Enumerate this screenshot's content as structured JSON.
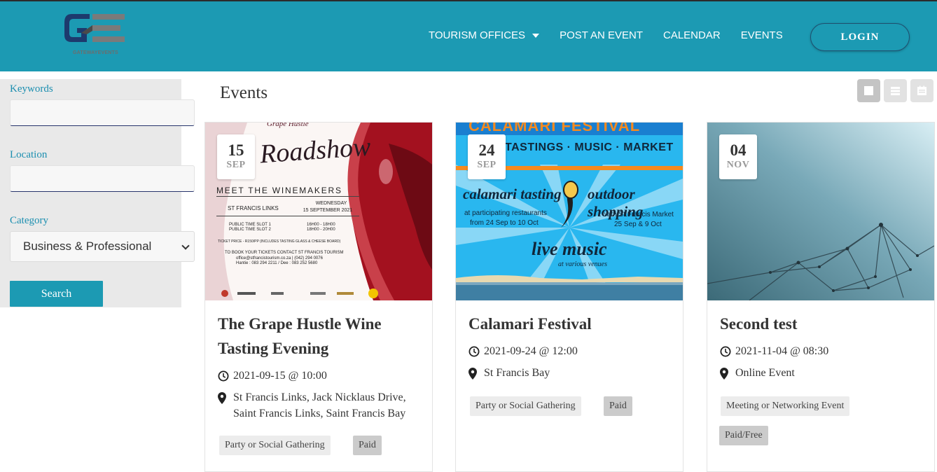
{
  "brand": {
    "logo_text": "GE",
    "sub_gateway": "GATEWAY",
    "sub_events": "EVENTS",
    "primary_color": "#1c9ab3"
  },
  "nav": {
    "items": [
      "TOURISM OFFICES",
      "POST AN EVENT",
      "CALENDAR",
      "EVENTS"
    ],
    "login": "LOGIN"
  },
  "sidebar": {
    "keywords_label": "Keywords",
    "keywords_value": "",
    "location_label": "Location",
    "location_value": "",
    "category_label": "Category",
    "category_selected": "Business & Professional",
    "search_button": "Search"
  },
  "main": {
    "title": "Events",
    "view_modes": [
      "grid-view-icon",
      "list-view-icon",
      "calendar-view-icon"
    ]
  },
  "events": [
    {
      "day": "15",
      "month": "SEP",
      "title": "The Grape Hustle Wine Tasting Evening",
      "datetime": "2021-09-15 @ 10:00",
      "location": "St Francis Links, Jack Nicklaus Drive, Saint Francis Links, Saint Francis Bay",
      "tags": [
        "Party or Social Gathering",
        "Paid"
      ],
      "poster": {
        "brand": "Grape Hustle",
        "script": "Roadshow",
        "headline": "MEET THE WINEMAKERS",
        "venue": "ST FRANCIS LINKS",
        "weekday": "WEDNESDAY",
        "date": "15 SEPTEMBER 2021",
        "slot1": "PUBLIC TIME SLOT 1",
        "slot1_time": "16H00 - 18H00",
        "slot2": "PUBLIC TIME SLOT 2",
        "slot2_time": "18H00 - 20H00",
        "price": "TICKET PRICE - R150/PP (INCLUDES TASTING GLASS & CHEESE BOARD)",
        "booking": "TO BOOK YOUR TICKETS CONTACT ST FRANCIS TOURISM",
        "email": "office@stfrancistourism.co.za | (042) 294 0076",
        "phones": "Hantie : 083 294 2211 / Dee : 083 252 5680"
      }
    },
    {
      "day": "24",
      "month": "SEP",
      "title": "Calamari Festival",
      "datetime": "2021-09-24 @ 12:00",
      "location": "St Francis Bay",
      "tags": [
        "Party or Social Gathering",
        "Paid"
      ],
      "poster": {
        "top": "CALAMARI FESTIVAL",
        "line": "TASTINGS · MUSIC · MARKET",
        "left_title": "calamari tasting",
        "left_sub1": "at participating restaurants",
        "left_sub2": "from 24 Sep to 10 Oct",
        "right_title": "outdoor shopping",
        "right_sub1": "with St Francis Market",
        "right_sub2": "25 Sep & 9 Oct",
        "music": "live music",
        "music_sub": "at various venues"
      }
    },
    {
      "day": "04",
      "month": "NOV",
      "title": "Second test",
      "datetime": "2021-11-04 @ 08:30",
      "location": "Online Event",
      "tags": [
        "Meeting or Networking Event",
        "Paid/Free"
      ]
    }
  ]
}
